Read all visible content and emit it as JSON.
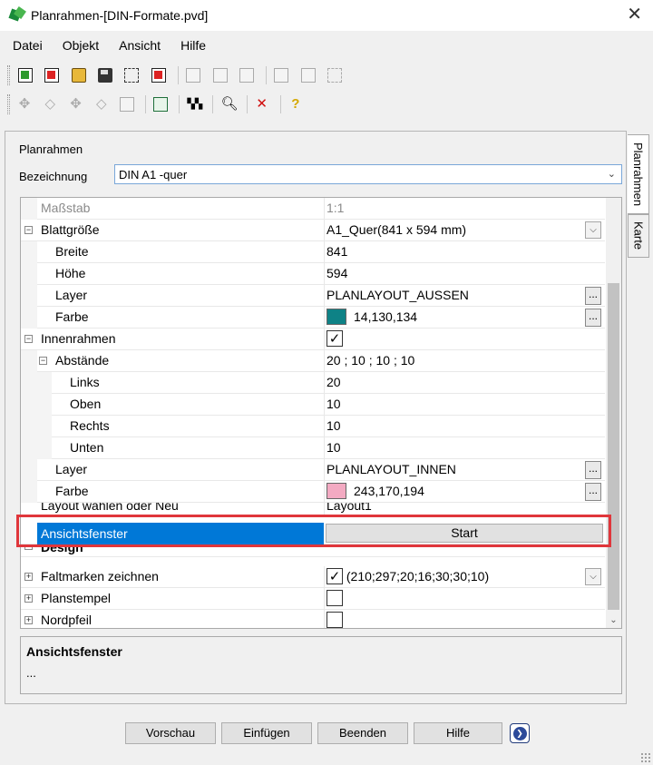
{
  "window": {
    "title": "Planrahmen-[DIN-Formate.pvd]",
    "close_glyph": "✕"
  },
  "menu": [
    "Datei",
    "Objekt",
    "Ansicht",
    "Hilfe"
  ],
  "toolbar1_icons": [
    "frame-green-icon",
    "frame-red-icon",
    "open-folder-icon",
    "save-icon",
    "select-frame-icon",
    "delete-frame-icon",
    "grey-check-icon",
    "grey-frame-icon",
    "grey-frame2-icon",
    "grey-save-icon",
    "grey-cross-icon",
    "grey-dash-icon"
  ],
  "toolbar2_icons": [
    "move-icon",
    "rotate-icon",
    "move-all-icon",
    "rotate-all-icon",
    "copy-icon",
    "window-icon",
    "pattern-icon",
    "magnifier-icon",
    "delete-icon",
    "help-icon"
  ],
  "panel": {
    "heading": "Planrahmen",
    "bezeichnung_label": "Bezeichnung",
    "bezeichnung_value": "DIN A1 -quer"
  },
  "grid": {
    "massstab": {
      "name": "Maßstab",
      "value": "1:1"
    },
    "blattgroesse": {
      "name": "Blattgröße",
      "value": "A1_Quer(841 x 594 mm)"
    },
    "breite": {
      "name": "Breite",
      "value": "841"
    },
    "hoehe": {
      "name": "Höhe",
      "value": "594"
    },
    "layer_aussen": {
      "name": "Layer",
      "value": "PLANLAYOUT_AUSSEN"
    },
    "farbe_aussen": {
      "name": "Farbe",
      "value": "14,130,134",
      "color": "#0e8286"
    },
    "innenrahmen": {
      "name": "Innenrahmen",
      "checked": "✓"
    },
    "abstaende": {
      "name": "Abstände",
      "value": "20 ; 10 ; 10 ; 10"
    },
    "links": {
      "name": "Links",
      "value": "20"
    },
    "oben": {
      "name": "Oben",
      "value": "10"
    },
    "rechts": {
      "name": "Rechts",
      "value": "10"
    },
    "unten": {
      "name": "Unten",
      "value": "10"
    },
    "layer_innen": {
      "name": "Layer",
      "value": "PLANLAYOUT_INNEN"
    },
    "farbe_innen": {
      "name": "Farbe",
      "value": "243,170,194",
      "color": "#f3aac2"
    },
    "layout": {
      "name": "Layout wählen oder Neu",
      "value": "Layout1"
    },
    "ansichtsfenster": {
      "name": "Ansichtsfenster",
      "button": "Start"
    },
    "design": {
      "name": "Design"
    },
    "faltmarken": {
      "name": "Faltmarken zeichnen",
      "checked": "✓",
      "value": "(210;297;20;16;30;30;10)"
    },
    "planstempel": {
      "name": "Planstempel"
    },
    "nordpfeil": {
      "name": "Nordpfeil"
    },
    "dots_label": "...",
    "dropdown_glyph": "⌵",
    "expander_minus": "−",
    "expander_plus": "+"
  },
  "description": {
    "title": "Ansichtsfenster",
    "text": "..."
  },
  "side_tabs": [
    "Planrahmen",
    "Karte"
  ],
  "footer": {
    "preview": "Vorschau",
    "insert": "Einfügen",
    "finish": "Beenden",
    "help": "Hilfe",
    "next_glyph": "❯"
  },
  "colors": {
    "selection": "#0078d7",
    "highlight": "#e0363b"
  }
}
